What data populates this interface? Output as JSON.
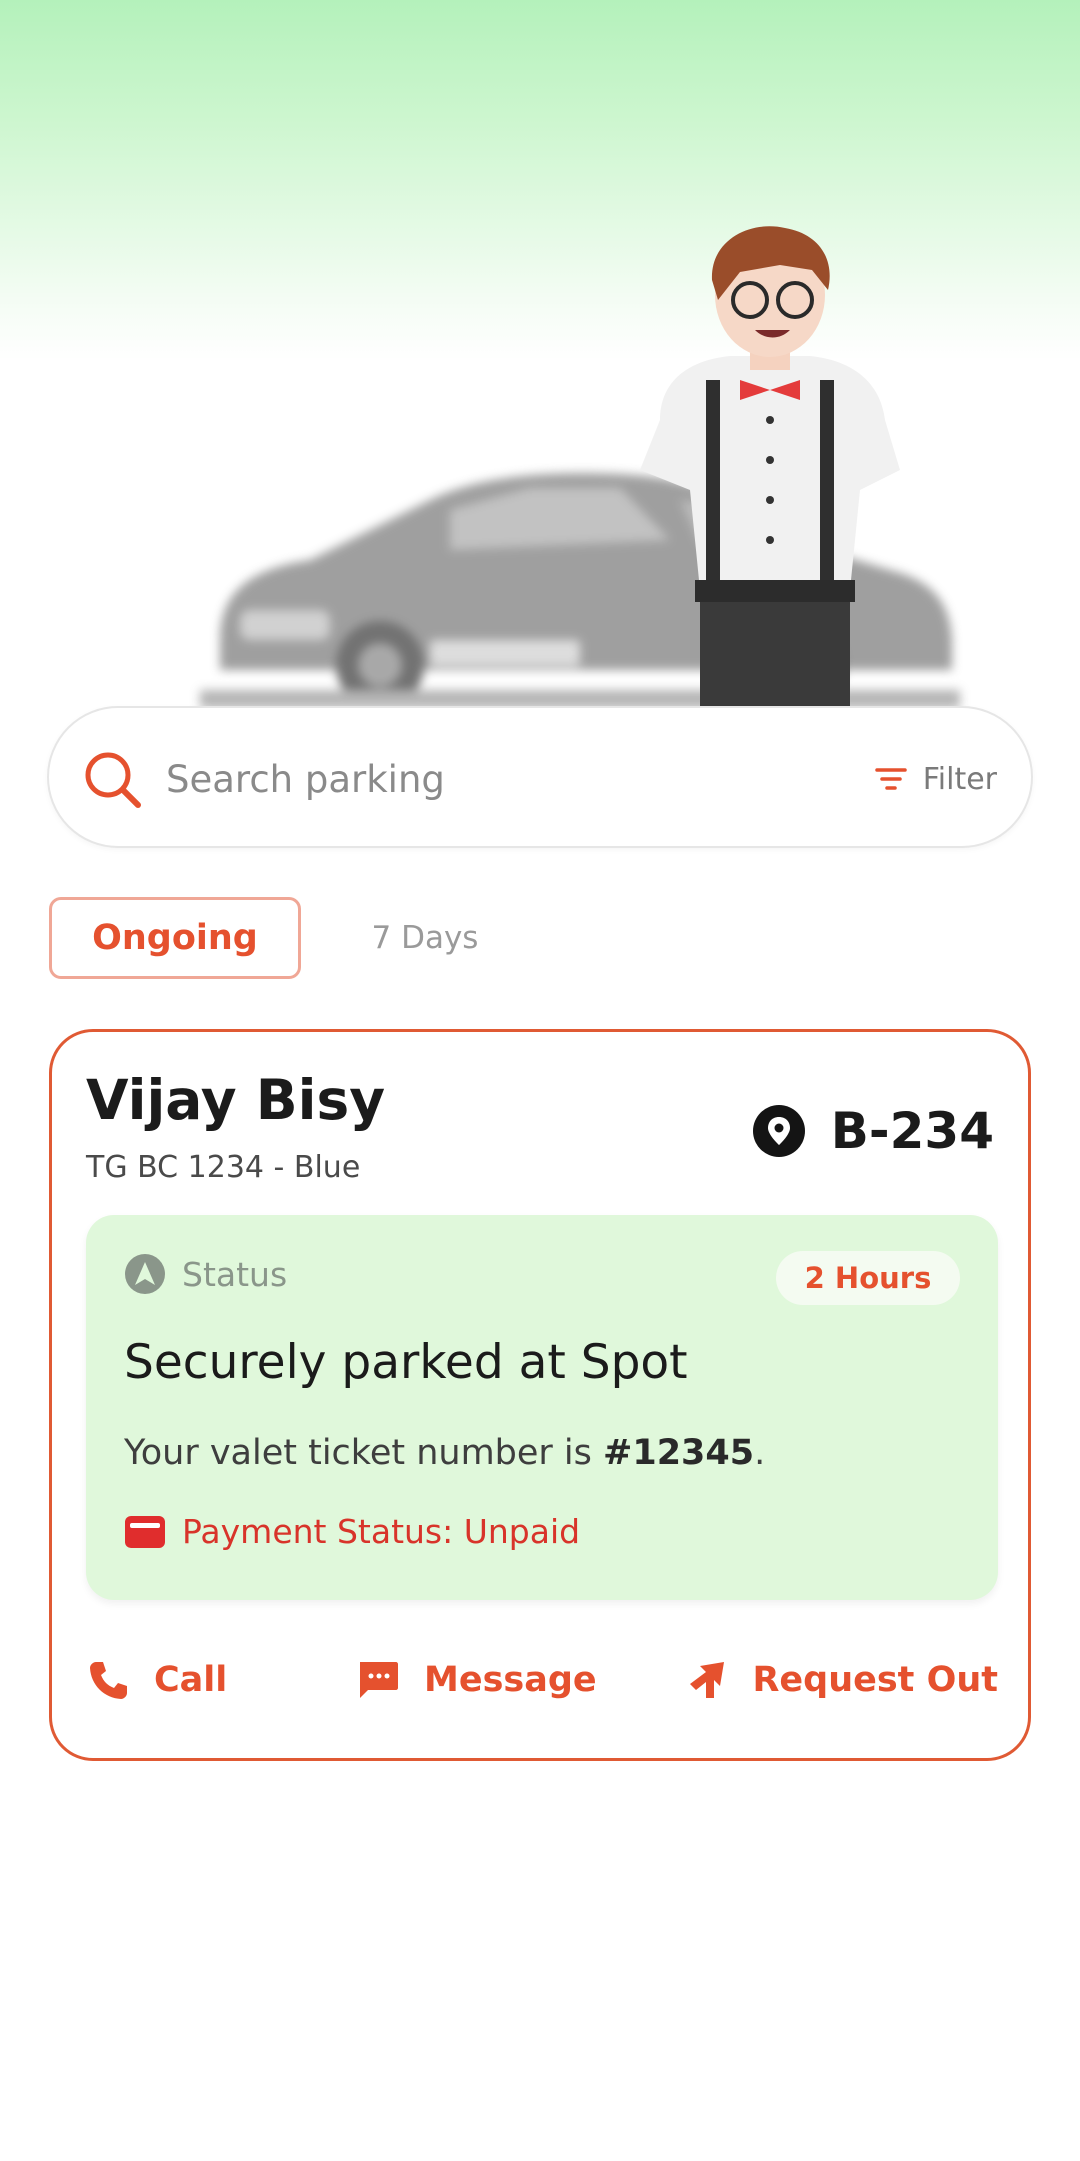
{
  "search": {
    "placeholder": "Search parking",
    "filter_label": "Filter"
  },
  "tabs": [
    {
      "label": "Ongoing",
      "active": true
    },
    {
      "label": "7 Days",
      "active": false
    }
  ],
  "booking": {
    "customer_name": "Vijay Bisy",
    "vehicle": "TG BC 1234 - Blue",
    "spot": "B-234",
    "status": {
      "label": "Status",
      "duration": "2 Hours",
      "title": "Securely parked at Spot",
      "ticket_prefix": "Your valet ticket number is ",
      "ticket_number": "#12345",
      "ticket_suffix": ".",
      "payment": "Payment Status: Unpaid"
    },
    "actions": {
      "call": "Call",
      "message": "Message",
      "request_out": "Request Out"
    }
  },
  "colors": {
    "accent": "#e5512e",
    "status_bg": "#e0f8db",
    "payment_red": "#d8342a",
    "hero_green": "#b4f1bb"
  },
  "icons": [
    "search-icon",
    "filter-icon",
    "location-pin-icon",
    "navigation-icon",
    "wallet-icon",
    "phone-icon",
    "message-icon",
    "request-out-icon"
  ]
}
